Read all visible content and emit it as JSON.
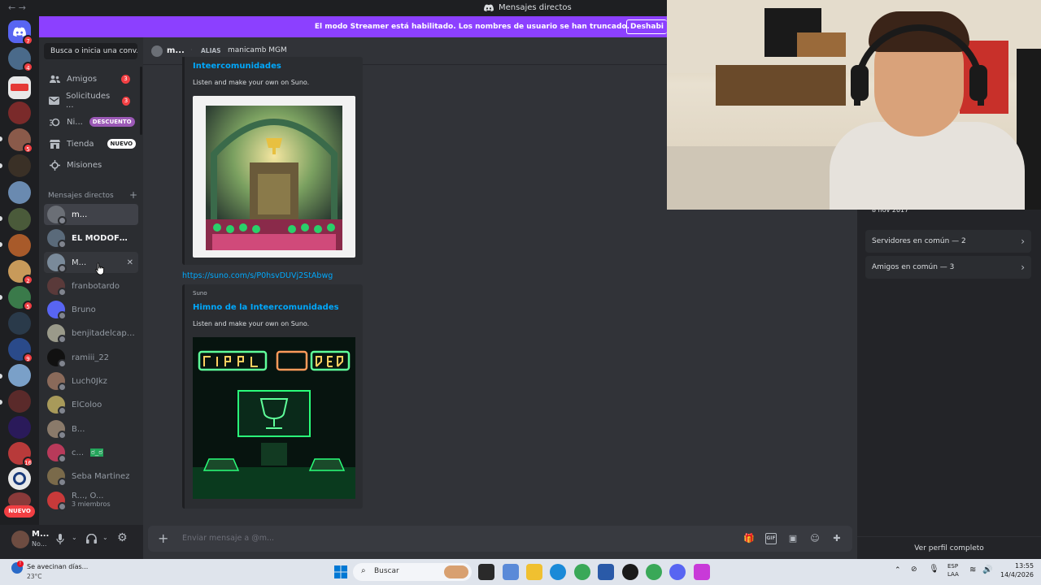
{
  "window": {
    "title": "Mensajes directos"
  },
  "banner": {
    "text": "El modo Streamer está habilitado. Los nombres de usuario se han truncado.",
    "button": "Deshabi"
  },
  "sidebar": {
    "search_placeholder": "Busca o inicia una conv...",
    "nav": [
      {
        "label": "Amigos",
        "count": "3",
        "icon": "friends-icon"
      },
      {
        "label": "Solicitudes ...",
        "count": "3",
        "icon": "envelope-icon"
      },
      {
        "label": "Ni...",
        "pill": "DESCUENTO",
        "icon": "nitro-icon"
      },
      {
        "label": "Tienda",
        "pill": "NUEVO",
        "icon": "shop-icon"
      },
      {
        "label": "Misiones",
        "icon": "quests-icon"
      }
    ],
    "dm_header": "Mensajes directos",
    "dms": [
      {
        "name": "m..."
      },
      {
        "name": "EL MODOFOC..."
      },
      {
        "name": "M..."
      },
      {
        "name": "franbotardo"
      },
      {
        "name": "Bruno"
      },
      {
        "name": "benjitadelcap ..."
      },
      {
        "name": "ramiii_22"
      },
      {
        "name": "Luch0Jkz"
      },
      {
        "name": "ElColoo"
      },
      {
        "name": "B..."
      },
      {
        "name": "c...",
        "emoji": "ಠ_ಠ"
      },
      {
        "name": "Seba Martinez"
      },
      {
        "name": "R..., O...",
        "sub": "3 miembros"
      }
    ]
  },
  "rail": {
    "new_badge": "NUEVO",
    "badges": [
      "7",
      "4",
      "5",
      "2",
      "5",
      "9",
      "16"
    ]
  },
  "user_panel": {
    "name": "M...",
    "status": "No..."
  },
  "chat_header": {
    "name": "m...",
    "alias_label": "ALIAS",
    "alias": "manicamb MGM"
  },
  "messages": {
    "embed1": {
      "title": "Inteercomunidades",
      "desc": "Listen and make your own on Suno."
    },
    "link": "https://suno.com/s/P0hsvDUVj2StAbwg",
    "embed2": {
      "provider": "Suno",
      "title": "Himno de la Inteercomunidades",
      "desc": "Listen and make your own on Suno."
    }
  },
  "composer": {
    "placeholder": "Enviar mensaje a @m..."
  },
  "profile": {
    "date": "8 nov 2017",
    "servers": "Servidores en común — 2",
    "friends": "Amigos en común — 3",
    "view_full": "Ver perfil completo"
  },
  "taskbar": {
    "weather": "Se avecinan días...",
    "temp": "23°C",
    "search": "Buscar",
    "lang1": "ESP",
    "lang2": "LAA",
    "time": "13:55",
    "date": "14/4/2026"
  },
  "colors": {
    "blurple": "#5865f2",
    "streamer": "#8c40ff",
    "link": "#00a8fc",
    "red": "#f23f43"
  }
}
